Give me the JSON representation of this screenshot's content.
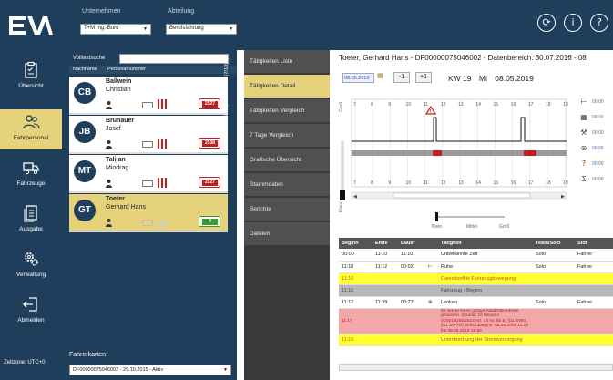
{
  "topbar": {
    "company_label": "Unternehmen",
    "company_value": "T+M Ing.-Buro",
    "department_label": "Abteilung",
    "department_value": "Berufsfahrung"
  },
  "nav": {
    "items": [
      {
        "label": "Übersicht",
        "icon": "clipboard-icon"
      },
      {
        "label": "Fahrpersonal",
        "icon": "people-icon"
      },
      {
        "label": "Fahrzeuge",
        "icon": "truck-icon"
      },
      {
        "label": "Ausgabe",
        "icon": "document-icon"
      },
      {
        "label": "Verwaltung",
        "icon": "gears-icon"
      },
      {
        "label": "Abmelden",
        "icon": "logout-icon"
      }
    ],
    "version": "Zeitzone: UTC+0"
  },
  "list": {
    "search_label": "Volltextsuche",
    "col_name": "Nachname",
    "col_number": "Personalnummer",
    "vertical_label": "Fahrpersonalfilter (7/10)",
    "drivers": [
      {
        "initials": "CB",
        "last": "Ballwein",
        "first": "Christian",
        "badge": "2527"
      },
      {
        "initials": "JB",
        "last": "Brunauer",
        "first": "Josef",
        "badge": "2538"
      },
      {
        "initials": "MT",
        "last": "Talijan",
        "first": "Miodrag",
        "badge": "2527"
      },
      {
        "initials": "GT",
        "last": "Toeter",
        "first": "Gerhard Hans",
        "badge": "4"
      }
    ],
    "cards_label": "Fahrerkarten:",
    "cards_value": "DF00000075046002 - 29.10.2015 - Aktiv"
  },
  "tabs": [
    "Tätigkeiten Liste",
    "Tätigkeiten Detail",
    "Tätigkeiten Vergleich",
    "7 Tage Vergleich",
    "Grafische Übersicht",
    "Stammdaten",
    "Berichte",
    "Dateien"
  ],
  "detail": {
    "title": "Toeter, Gerhard Hans - DF00000075046002 - Datenbereich: 30.07.2016 - 08",
    "date": "08.05.2019",
    "prev_label": "-1",
    "next_label": "+1",
    "kw": "KW 19",
    "day": "Mi",
    "date_long": "08.05.2019",
    "axis_hours": [
      "7",
      "8",
      "9",
      "10",
      "11",
      "12",
      "13",
      "14",
      "15",
      "16",
      "17",
      "18",
      "19"
    ],
    "zoom_labels": [
      "Klein",
      "Mittel",
      "Groß"
    ],
    "y_top_label": "Groß",
    "y_bottom_label": "Klein",
    "legend": [
      {
        "icon": "bed-icon",
        "value": "00:00"
      },
      {
        "icon": "grid-icon",
        "value": "00:00"
      },
      {
        "icon": "hammer-icon",
        "value": "00:00"
      },
      {
        "icon": "steering-icon",
        "value": "00:00"
      },
      {
        "icon": "question-icon",
        "value": "00:00"
      },
      {
        "icon": "sum-icon",
        "value": "00:00"
      }
    ],
    "table": {
      "headers": [
        "Beginn",
        "Ende",
        "Dauer",
        "Tätigkeit",
        "Typ",
        "Team/Solo",
        "Slot"
      ],
      "rows": [
        {
          "style": "",
          "beginn": "00:00",
          "ende": "11:10",
          "dauer": "11:10",
          "icon": "",
          "taetigkeit": "Unbekannte Zeit",
          "team": "Solo",
          "slot": "Fahrer"
        },
        {
          "style": "",
          "beginn": "11:10",
          "ende": "11:12",
          "dauer": "00:02",
          "icon": "bed-icon",
          "taetigkeit": "Ruhe",
          "team": "Solo",
          "slot": "Fahrer"
        },
        {
          "style": "yellow",
          "beginn": "11:10",
          "ende": "",
          "dauer": "",
          "icon": "",
          "taetigkeit": "Datenkonflikt Fahrzeugbewegung",
          "team": "",
          "slot": ""
        },
        {
          "style": "grey",
          "beginn": "11:10",
          "ende": "",
          "dauer": "",
          "icon": "",
          "taetigkeit": "Fahrzeug - Beginn",
          "team": "",
          "slot": ""
        },
        {
          "style": "",
          "beginn": "11:12",
          "ende": "11:39",
          "dauer": "00:27",
          "icon": "steering-icon",
          "taetigkeit": "Lenken",
          "team": "Solo",
          "slot": "Fahrer"
        },
        {
          "style": "pink",
          "beginn": "11:17",
          "ende": "",
          "dauer": "",
          "icon": "",
          "taetigkeit": "Es wurde keine gültige Abfahrtskontrolle gefunden. (Grund: 10 Minuten VO(EU)165/2014 Art. 34 Nr. 5b E, §11 SWG, §11 SWTO) Schichtbeginn: 08.05.2019 11:12 bis 08.05.2019 18:59",
          "team": "",
          "slot": ""
        },
        {
          "style": "yellow",
          "beginn": "11:16",
          "ende": "",
          "dauer": "",
          "icon": "",
          "taetigkeit": "Unterbrechung der Stromversorgung",
          "team": "",
          "slot": ""
        }
      ]
    }
  },
  "colors": {
    "navy": "#1e3e5c",
    "accent_yellow": "#e6d27a",
    "alert_red": "#c02020",
    "ok_green": "#3a9a3a"
  }
}
